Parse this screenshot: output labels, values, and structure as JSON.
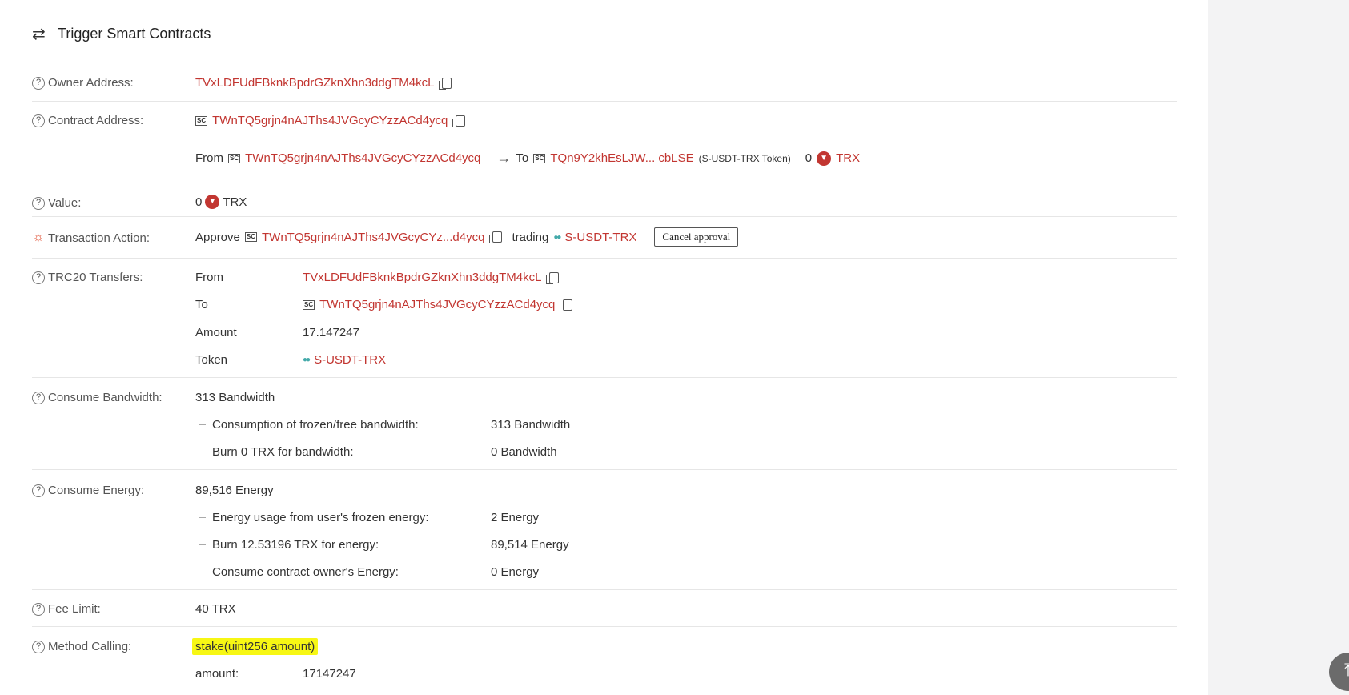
{
  "title": "Trigger Smart Contracts",
  "owner": {
    "label": "Owner Address:",
    "address": "TVxLDFUdFBknkBpdrGZknXhn3ddgTM4kcL"
  },
  "contract": {
    "label": "Contract Address:",
    "address": "TWnTQ5grjn4nAJThs4JVGcyCYzzACd4ycq",
    "from_label": "From",
    "from_address": "TWnTQ5grjn4nAJThs4JVGcyCYzzACd4ycq",
    "to_label": "To",
    "to_address": "TQn9Y2khEsLJW... cbLSE",
    "to_token": "(S-USDT-TRX Token)",
    "amount": "0",
    "currency": "TRX",
    "sc_badge": "SC"
  },
  "value": {
    "label": "Value:",
    "amount": "0",
    "currency": "TRX"
  },
  "action": {
    "label": "Transaction Action:",
    "approve": "Approve",
    "address": "TWnTQ5grjn4nAJThs4JVGcyCYz...d4ycq",
    "trading": "trading",
    "token": "S-USDT-TRX",
    "cancel_button": "Cancel approval"
  },
  "trc20": {
    "label": "TRC20 Transfers:",
    "from_label": "From",
    "from_value": "TVxLDFUdFBknkBpdrGZknXhn3ddgTM4kcL",
    "to_label": "To",
    "to_value": "TWnTQ5grjn4nAJThs4JVGcyCYzzACd4ycq",
    "amount_label": "Amount",
    "amount_value": "17.147247",
    "token_label": "Token",
    "token_value": "S-USDT-TRX"
  },
  "bandwidth": {
    "label": "Consume Bandwidth:",
    "total": "313 Bandwidth",
    "items": [
      {
        "label": "Consumption of frozen/free bandwidth:",
        "value": "313 Bandwidth"
      },
      {
        "label": "Burn 0 TRX for bandwidth:",
        "value": "0 Bandwidth"
      }
    ]
  },
  "energy": {
    "label": "Consume Energy:",
    "total": "89,516 Energy",
    "items": [
      {
        "label": "Energy usage from user's frozen energy:",
        "value": "2 Energy"
      },
      {
        "label": "Burn 12.53196 TRX for energy:",
        "value": "89,514 Energy"
      },
      {
        "label": "Consume contract owner's Energy:",
        "value": "0 Energy"
      }
    ]
  },
  "fee": {
    "label": "Fee Limit:",
    "value": "40 TRX"
  },
  "method": {
    "label": "Method Calling:",
    "value": "stake(uint256 amount)",
    "param_label": "amount:",
    "param_value": "17147247"
  },
  "icons": {
    "title": "swap-icon",
    "help": "question-circle-icon",
    "action": "bulb-icon",
    "copy": "copy-icon",
    "trx": "trx-logo-icon",
    "scroll": "scroll-to-top-icon"
  },
  "colors": {
    "link": "#c23631",
    "highlight": "#f7f714"
  }
}
